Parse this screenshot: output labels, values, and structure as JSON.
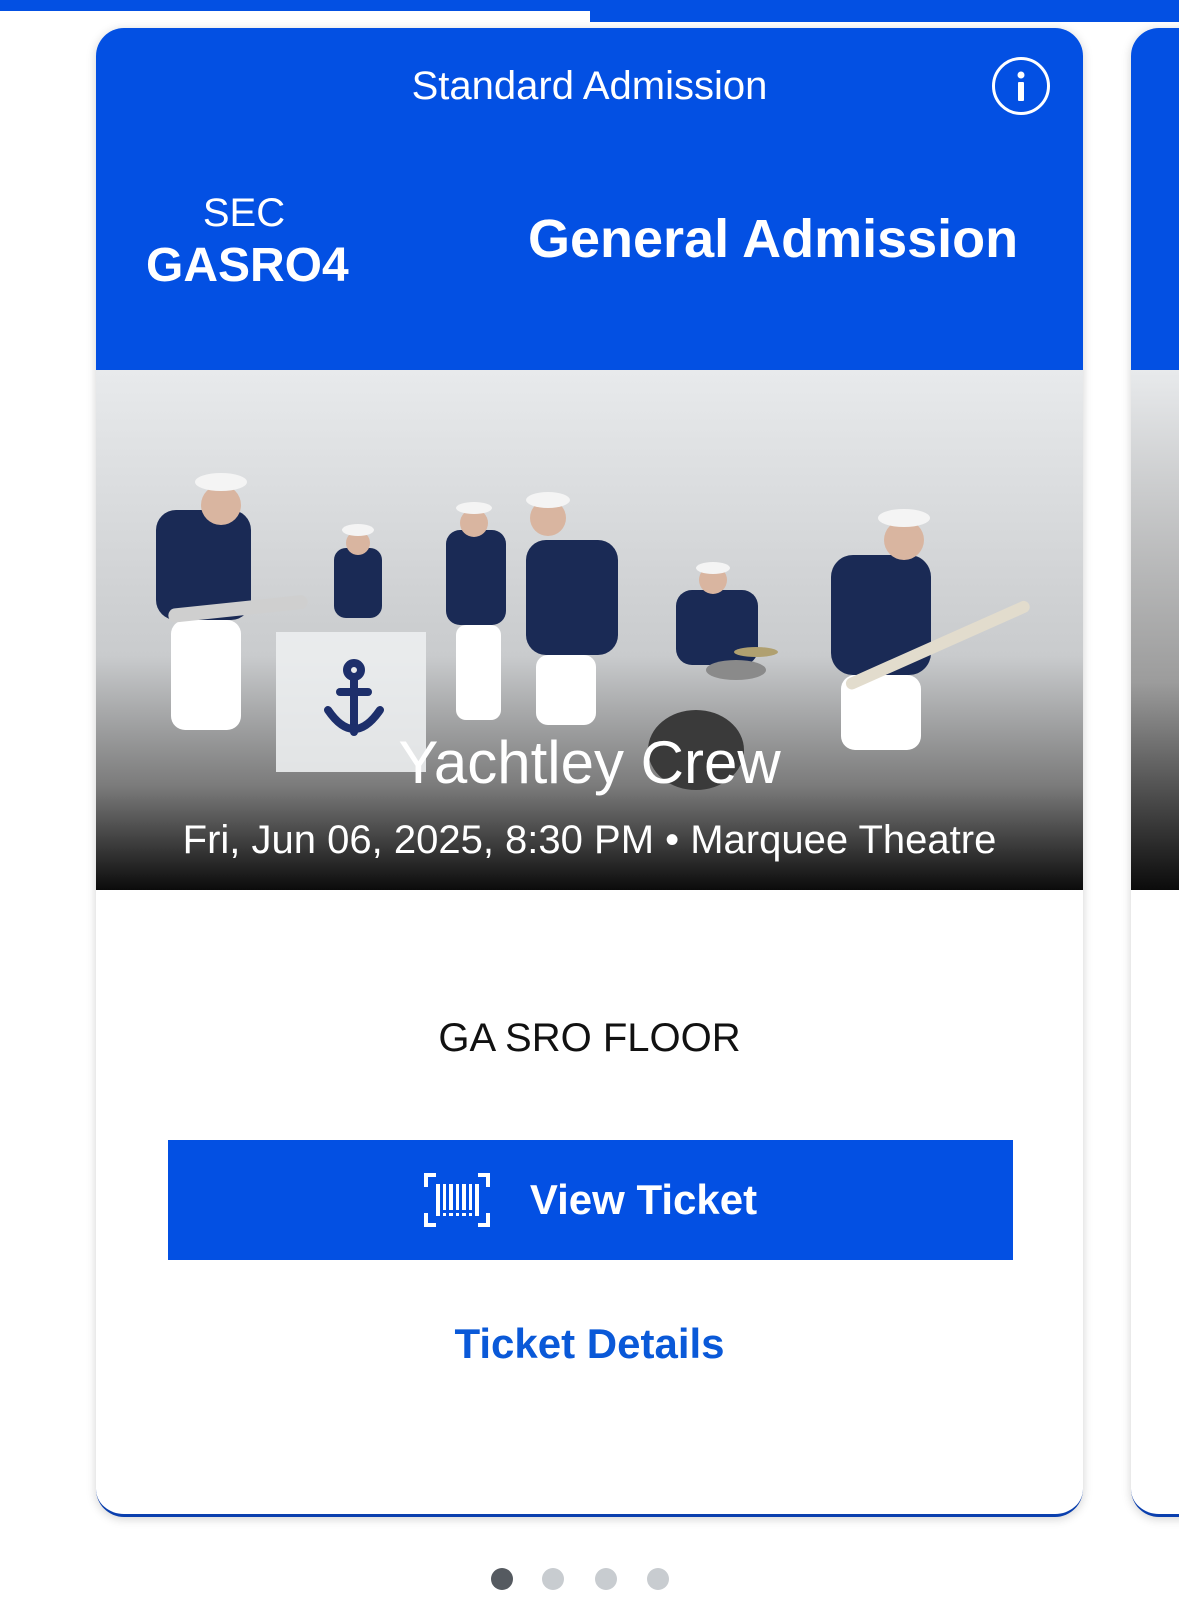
{
  "ticket": {
    "admission_type": "Standard Admission",
    "section_label": "SEC",
    "section_code": "GASRO4",
    "section_name": "General Admission",
    "area": "GA SRO FLOOR"
  },
  "event": {
    "title": "Yachtley Crew",
    "meta": "Fri, Jun 06, 2025, 8:30 PM • Marquee Theatre"
  },
  "actions": {
    "view_ticket_label": "View Ticket",
    "ticket_details_label": "Ticket Details"
  },
  "pager": {
    "count": 4,
    "active_index": 0
  },
  "icons": {
    "info": "info-icon",
    "barcode": "barcode-scan-icon",
    "anchor": "anchor-icon"
  },
  "colors": {
    "brand_blue": "#0350e3",
    "link_blue": "#0a59d8",
    "dot_active": "#555a60",
    "dot_inactive": "#c8ccd0"
  }
}
